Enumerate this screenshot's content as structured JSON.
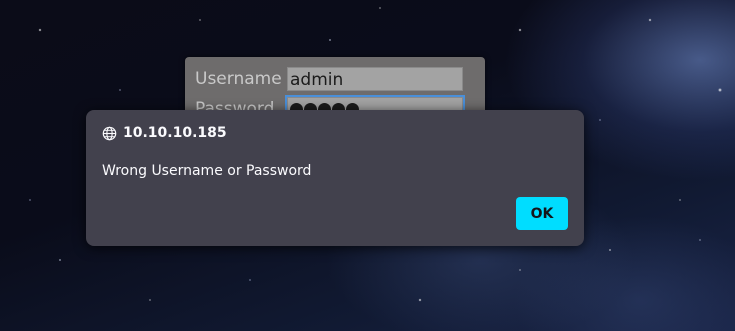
{
  "login_form": {
    "username_label": "Username",
    "username_value": "admin",
    "password_label": "Password",
    "password_masked_chars": 5
  },
  "dialog": {
    "origin": "10.10.10.185",
    "message": "Wrong Username or Password",
    "ok_label": "OK",
    "icon": "globe-icon",
    "accent_color": "#00ddff",
    "background_color": "#42414d"
  }
}
